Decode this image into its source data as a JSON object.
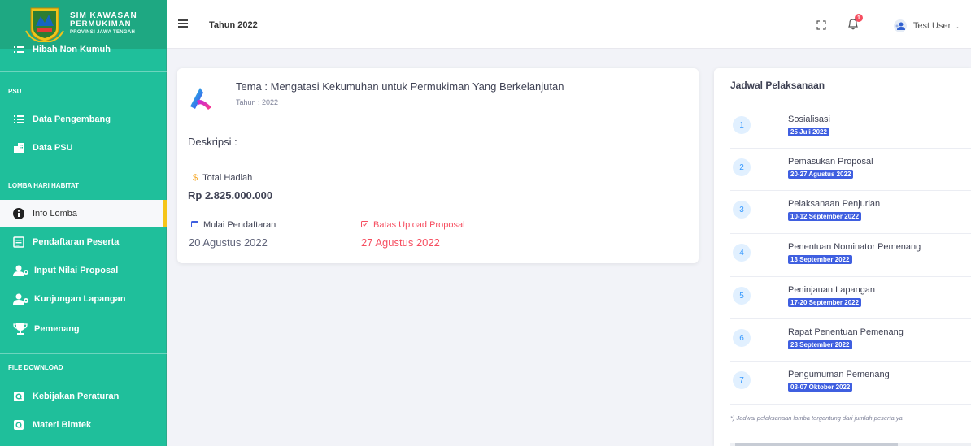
{
  "brand": {
    "line1": "SIM KAWASAN",
    "line2": "PERMUKIMAN",
    "line3": "PROVINSI JAWA TENGAH"
  },
  "sidebar": {
    "top_partial_item": "Hibah Non Kumuh",
    "sections": [
      {
        "title": "PSU",
        "items": [
          {
            "label": "Data Pengembang",
            "icon": "list-icon"
          },
          {
            "label": "Data PSU",
            "icon": "building-icon"
          }
        ]
      },
      {
        "title": "LOMBA HARI HABITAT",
        "items": [
          {
            "label": "Info Lomba",
            "icon": "info-icon"
          },
          {
            "label": "Pendaftaran Peserta",
            "icon": "form-icon"
          },
          {
            "label": "Input Nilai Proposal",
            "icon": "users-icon"
          },
          {
            "label": "Kunjungan Lapangan",
            "icon": "users-icon"
          },
          {
            "label": "Pemenang",
            "icon": "trophy-icon"
          }
        ]
      },
      {
        "title": "FILE DOWNLOAD",
        "items": [
          {
            "label": "Kebijakan Peraturan",
            "icon": "file-icon"
          },
          {
            "label": "Materi Bimtek",
            "icon": "file-icon"
          }
        ]
      }
    ]
  },
  "header": {
    "year_label": "Tahun 2022",
    "notification_count": "1",
    "user_name": "Test User"
  },
  "info_card": {
    "title": "Tema : Mengatasi Kekumuhan untuk Permukiman Yang Berkelanjutan",
    "year": "Tahun : 2022",
    "description_label": "Deskripsi :",
    "prize_label": "Total Hadiah",
    "prize_value": "Rp 2.825.000.000",
    "registration_label": "Mulai Pendaftaran",
    "registration_date": "20 Agustus 2022",
    "upload_label": "Batas Upload Proposal",
    "upload_date": "27 Agustus 2022"
  },
  "schedule": {
    "title": "Jadwal Pelaksanaan",
    "items": [
      {
        "num": "1",
        "name": "Sosialisasi",
        "date": "25 Juli 2022"
      },
      {
        "num": "2",
        "name": "Pemasukan Proposal",
        "date": "20-27 Agustus 2022"
      },
      {
        "num": "3",
        "name": "Pelaksanaan Penjurian",
        "date": "10-12 September 2022"
      },
      {
        "num": "4",
        "name": "Penentuan Nominator Pemenang",
        "date": "13 September 2022"
      },
      {
        "num": "5",
        "name": "Peninjauan Lapangan",
        "date": "17-20 September 2022"
      },
      {
        "num": "6",
        "name": "Rapat Penentuan Pemenang",
        "date": "23 September 2022"
      },
      {
        "num": "7",
        "name": "Pengumuman Pemenang",
        "date": "03-07 Oktober 2022"
      }
    ],
    "note": "*) Jadwal pelaksanaan lomba tergantung dari jumlah peserta ya"
  },
  "colors": {
    "sidebar": "#1fbf9b",
    "accent_yellow": "#f5c518",
    "danger": "#f64e60",
    "badge_blue": "#3f5fe0"
  }
}
